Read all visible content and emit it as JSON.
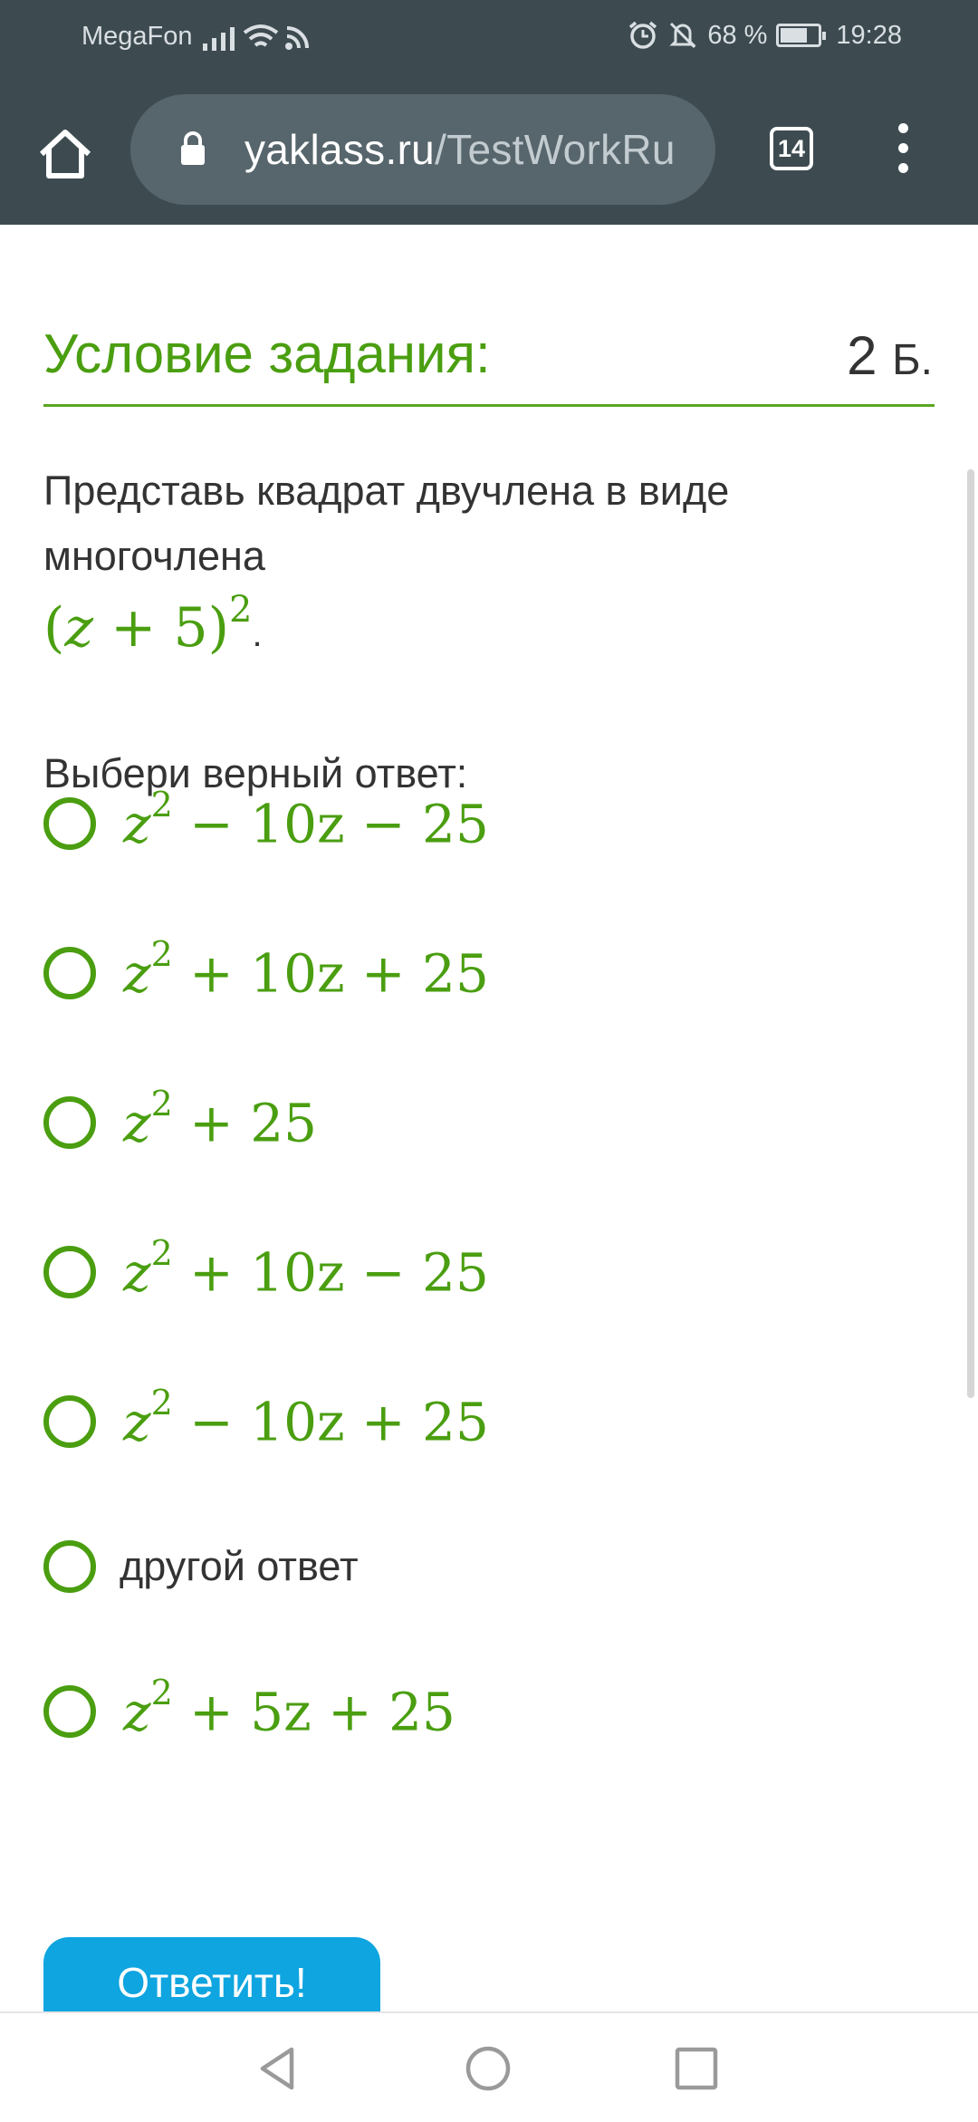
{
  "status_bar": {
    "carrier": "MegaFon",
    "battery": "68 %",
    "time": "19:28"
  },
  "browser": {
    "url_domain": "yaklass.ru",
    "url_path": "/TestWorkRu",
    "tab_count": "14"
  },
  "task": {
    "title": "Условие задания:",
    "points_value": "2",
    "points_unit": "Б.",
    "question": "Представь квадрат двучлена в виде многочлена",
    "expression": {
      "open": "(",
      "var": "z",
      "rest": " + 5)",
      "exp": "2",
      "dot": "."
    },
    "choose_label": "Выбери верный ответ:",
    "options": [
      {
        "base": "z",
        "exp": "2",
        "rest": " − 10z − 25"
      },
      {
        "base": "z",
        "exp": "2",
        "rest": " + 10z + 25"
      },
      {
        "base": "z",
        "exp": "2",
        "rest": " + 25"
      },
      {
        "base": "z",
        "exp": "2",
        "rest": " + 10z − 25"
      },
      {
        "base": "z",
        "exp": "2",
        "rest": " − 10z + 25"
      },
      {
        "text": "другой ответ"
      },
      {
        "base": "z",
        "exp": "2",
        "rest": " + 5z + 25"
      }
    ],
    "submit_label": "Ответить!"
  },
  "colors": {
    "toolbar": "#3d4b51",
    "accent_green": "#4a9e10",
    "button_blue": "#0ea5e0"
  },
  "icons": [
    "home-icon",
    "lock-icon",
    "tabs-icon",
    "menu-icon",
    "alarm-icon",
    "mute-icon",
    "battery-icon",
    "back-icon",
    "home-circle-icon",
    "recents-icon"
  ]
}
